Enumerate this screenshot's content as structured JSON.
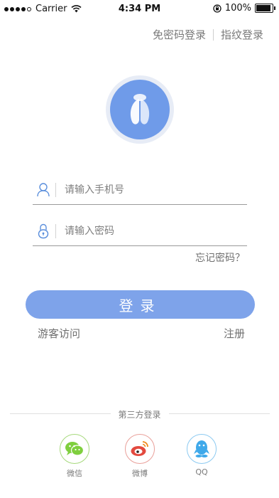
{
  "status_bar": {
    "carrier": "Carrier",
    "time": "4:34 PM",
    "battery": "100%",
    "battery_level": 1.0
  },
  "top_links": {
    "password_free": "免密码登录",
    "fingerprint": "指纹登录"
  },
  "form": {
    "phone": {
      "placeholder": "请输入手机号",
      "value": ""
    },
    "password": {
      "placeholder": "请输入密码",
      "value": ""
    },
    "forgot": "忘记密码？",
    "login_label": "登录"
  },
  "links": {
    "guest": "游客访问",
    "register": "注册"
  },
  "third_party": {
    "title": "第三方登录",
    "items": [
      {
        "label": "微信",
        "icon": "wechat-icon",
        "color": "#7fcf3e"
      },
      {
        "label": "微博",
        "icon": "weibo-icon",
        "color": "#e34a3f"
      },
      {
        "label": "QQ",
        "icon": "qq-icon",
        "color": "#3fa9ea"
      }
    ]
  },
  "colors": {
    "accent": "#7ea3ea",
    "logo": "#6f9be9",
    "input_icon": "#5b8fdc"
  }
}
